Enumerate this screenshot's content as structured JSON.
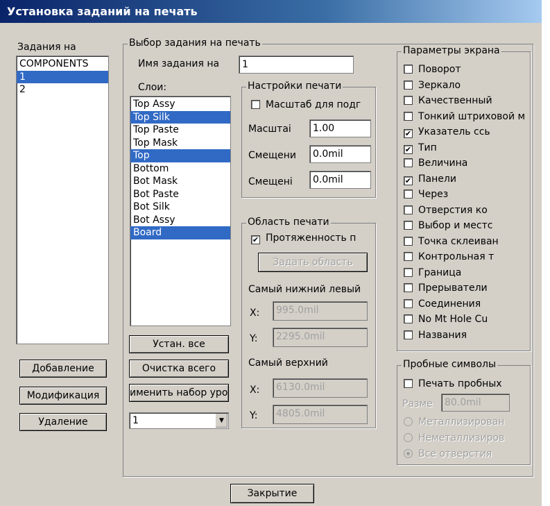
{
  "window": {
    "title": "Установка заданий на печать"
  },
  "jobs": {
    "label": "Задания на",
    "items": [
      "COMPONENTS",
      "1",
      "2"
    ],
    "selected_index": 1,
    "add_button": "Добавление",
    "modify_button": "Модификация",
    "delete_button": "Удаление"
  },
  "job_select": {
    "group_label": "Выбор задания на печать",
    "name_label": "Имя задания на",
    "name_value": "1",
    "layers_label": "Слои:",
    "layers": [
      {
        "label": "Top Assy",
        "selected": false
      },
      {
        "label": "Top Silk",
        "selected": true
      },
      {
        "label": "Top Paste",
        "selected": false
      },
      {
        "label": "Top Mask",
        "selected": false
      },
      {
        "label": "Top",
        "selected": true
      },
      {
        "label": "Bottom",
        "selected": false
      },
      {
        "label": "Bot Mask",
        "selected": false
      },
      {
        "label": "Bot Paste",
        "selected": false
      },
      {
        "label": "Bot Silk",
        "selected": false
      },
      {
        "label": "Bot Assy",
        "selected": false
      },
      {
        "label": "Board",
        "selected": true
      }
    ],
    "set_all_button": "Устан. все",
    "clear_all_button": "Очистка всего",
    "apply_set_button": "именить набор уров",
    "combo_value": "1"
  },
  "print_settings": {
    "group_label": "Настройки печати",
    "scale_fit_label": "Масштаб для подг",
    "scale_label": "Масштаі",
    "scale_value": "1.00",
    "offset1_label": "Смещени",
    "offset1_value": "0.0mil",
    "offset2_label": "Смещені",
    "offset2_value": "0.0mil"
  },
  "print_area": {
    "group_label": "Область печати",
    "extents_label": "Протяженность п",
    "set_area_button": "Задать область",
    "lower_left_label": "Самый нижний левый",
    "ll_x_label": "X:",
    "ll_x_value": "995.0mil",
    "ll_y_label": "Y:",
    "ll_y_value": "2295.0mil",
    "upper_label": "Самый верхний",
    "ur_x_label": "X:",
    "ur_x_value": "6130.0mil",
    "ur_y_label": "Y:",
    "ur_y_value": "4805.0mil"
  },
  "display_params": {
    "group_label": "Параметры экрана",
    "items": [
      {
        "label": "Поворот",
        "checked": false
      },
      {
        "label": "Зеркало",
        "checked": false
      },
      {
        "label": "Качественный",
        "checked": false
      },
      {
        "label": "Тонкий штриховой ме",
        "checked": false
      },
      {
        "label": "Указатель ссь",
        "checked": true
      },
      {
        "label": "Тип",
        "checked": true
      },
      {
        "label": "Величина",
        "checked": false
      },
      {
        "label": "Панели",
        "checked": true
      },
      {
        "label": "Через",
        "checked": false
      },
      {
        "label": "Отверстия ко",
        "checked": false
      },
      {
        "label": "Выбор и местс",
        "checked": false
      },
      {
        "label": "Точка склеиван",
        "checked": false
      },
      {
        "label": "Контрольная т",
        "checked": false
      },
      {
        "label": "Граница",
        "checked": false
      },
      {
        "label": "Прерыватели",
        "checked": false
      },
      {
        "label": "Соединения",
        "checked": false
      },
      {
        "label": "No Mt Hole Cu",
        "checked": false
      },
      {
        "label": "Названия",
        "checked": false
      }
    ]
  },
  "drill_symbols": {
    "group_label": "Пробные символы",
    "print_label": "Печать пробных",
    "size_label": "Разме",
    "size_value": "80.0mil",
    "radio_metal": "Металлизирован",
    "radio_nonmetal": "Неметаллизиров",
    "radio_all": "Все отверстия"
  },
  "close_button": "Закрытие"
}
